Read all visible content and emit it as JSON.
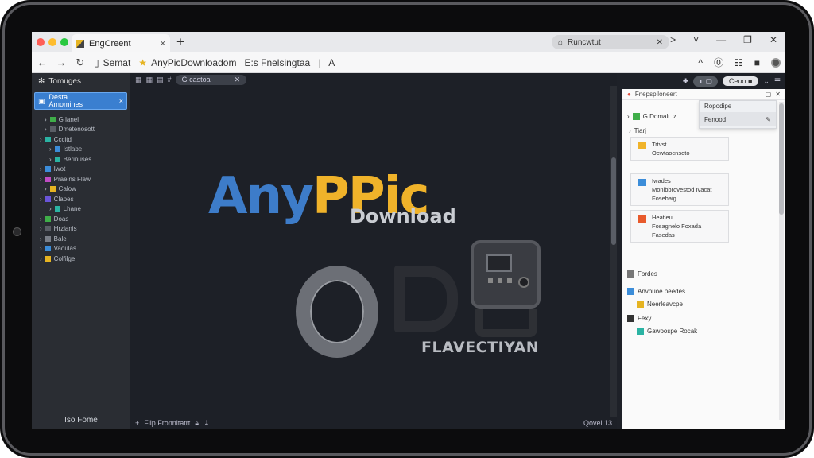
{
  "window": {
    "tab_title": "EngCreent",
    "tab_close": "×",
    "new_tab": "+",
    "pill_text": "Runcwtut",
    "pill_close": "✕",
    "controls": [
      ">",
      "˅",
      "—",
      "❐",
      "✕"
    ],
    "traffic_colors": [
      "#ff5f57",
      "#febc2e",
      "#28c840"
    ]
  },
  "address": {
    "back": "←",
    "forward": "→",
    "reload": "↻",
    "seg1": "Semat",
    "seg2": "AnyPicDownloadom",
    "seg3": "E:s  Fnelsingtaa",
    "seg4": "A",
    "right": [
      "^",
      "⓪",
      "☷",
      "■"
    ]
  },
  "sidebar": {
    "header": "Tomuges",
    "active_label_1": "Desta",
    "active_label_2": "Amomines",
    "active_close": "×",
    "items": [
      {
        "label": "G lanel",
        "color": "#3fae49"
      },
      {
        "label": "Dmetenosott",
        "color": "#5a5e66"
      },
      {
        "label": "Cccitd",
        "color": "#2bb3a3"
      },
      {
        "label": "Istlabe",
        "color": "#3c8dd9"
      },
      {
        "label": "Berinuses",
        "color": "#2bb3a3"
      },
      {
        "label": "Iwot",
        "color": "#3c8dd9"
      },
      {
        "label": "Praeins Flaw",
        "color": "#c04cc4"
      },
      {
        "label": "Calow",
        "color": "#e6b422"
      },
      {
        "label": "Clapes",
        "color": "#6a55d9"
      },
      {
        "label": "Lhane",
        "color": "#2bb3a3"
      },
      {
        "label": "Doas",
        "color": "#3fae49"
      },
      {
        "label": "Hrzlanis",
        "color": "#5a5e66"
      },
      {
        "label": "Bale",
        "color": "#7a7f88"
      },
      {
        "label": "Vaoulas",
        "color": "#3c8dd9"
      },
      {
        "label": "Colfilge",
        "color": "#e6b422"
      }
    ],
    "footer": "Iso Fome"
  },
  "canvas": {
    "search_chip": "G castoa",
    "chip_close": "✕",
    "logo_a": "Any",
    "logo_p": "P",
    "logo_pic": "Pic",
    "logo_download": "Download",
    "brand": "FLAVECTIYAN",
    "footer_left": "Fiip Fronnitatrt",
    "footer_right": "Qovei 13",
    "logo_colors": {
      "blue": "#3d7cc9",
      "yellow": "#f0b32a",
      "green": "#6fbf4a",
      "gray": "#9aa0a8"
    }
  },
  "right_panel": {
    "header_title": "Fnepspiloneert",
    "toolbar_pill": "Ceuo",
    "popover_title": "Ropodipe",
    "popover_field": "Fenood",
    "row_domain": "G Domalt. z",
    "row_tray": "Tiarj",
    "cards": [
      {
        "line1": "Trtvst",
        "line2": "Ocwtaocnsoto",
        "color": "#f0b32a"
      },
      {
        "line1": "Iwades",
        "line2": "Monibbrovestod Ivacat",
        "line3": "Fosebaig",
        "color": "#3c8dd9"
      },
      {
        "line1": "Heatleu",
        "line2": "Fosagnelo Foxada",
        "line3": "Fasedas",
        "color": "#e85a2c"
      }
    ],
    "rows_lower": [
      {
        "label": "Fordes",
        "color": "#777"
      },
      {
        "label": "Anvpuoe peedes",
        "color": "#3c8dd9"
      },
      {
        "label": "Neerleavcpe",
        "color": "#e6b422"
      },
      {
        "label": "Fexy",
        "color": "#333"
      },
      {
        "label": "Gawoospe Rocak",
        "color": "#2bb3a3"
      }
    ]
  }
}
